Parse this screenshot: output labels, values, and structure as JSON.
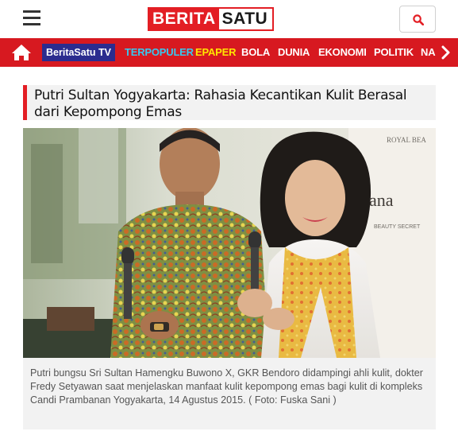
{
  "header": {
    "logo_part1": "BERITA",
    "logo_part2": "SATU",
    "menu_icon": "hamburger-menu-icon",
    "search_icon": "search-icon",
    "brand_color": "#e31e24"
  },
  "nav": {
    "home_icon": "home-icon",
    "tv_label": "BeritaSatu TV",
    "items": [
      "TERPOPULER",
      "EPAPER",
      "BOLA",
      "DUNIA",
      "EKONOMI",
      "POLITIK",
      "NA"
    ],
    "arrow_icon": "chevron-right-icon",
    "bg_color": "#d71920",
    "tv_color": "#2b2c8f",
    "popular_color": "#37c8f0",
    "epaper_color": "#ffe600"
  },
  "article": {
    "title": "Putri Sultan Yogyakarta: Rahasia Kecantikan Kulit Berasal dari Kepompong Emas",
    "caption": "Putri bungsu Sri Sultan Hamengku Buwono X, GKR Bendoro didampingi ahli kulit, dokter Fredy Setyawan saat menjelaskan manfaat kulit kepompong emas bagi kulit di kompleks Candi Prambanan Yogyakarta, 14 Agustus 2015. ( Foto: Fuska Sani )",
    "banner_text_1": "ROYAL BEA",
    "banner_text_2": "yana",
    "banner_text_3": "BEAUTY SECRET"
  }
}
